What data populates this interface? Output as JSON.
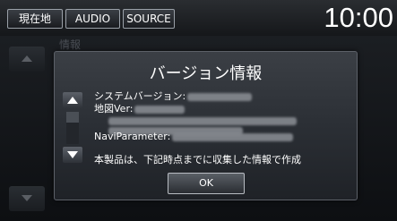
{
  "topbar": {
    "current_label": "現在地",
    "audio_label": "AUDIO",
    "source_label": "SOURCE",
    "clock": "10:00"
  },
  "background": {
    "header_text": "情報"
  },
  "dialog": {
    "title": "バージョン情報",
    "system_version_label": "システムバージョン:",
    "map_version_label": "地図Ver:",
    "navi_parameter_label": "NaviParameter:",
    "notice": "本製品は、下記時点までに収集した情報で作成",
    "ok_label": "OK"
  },
  "colors": {
    "accent_text": "#ffffff",
    "background": "#0b0d10"
  }
}
